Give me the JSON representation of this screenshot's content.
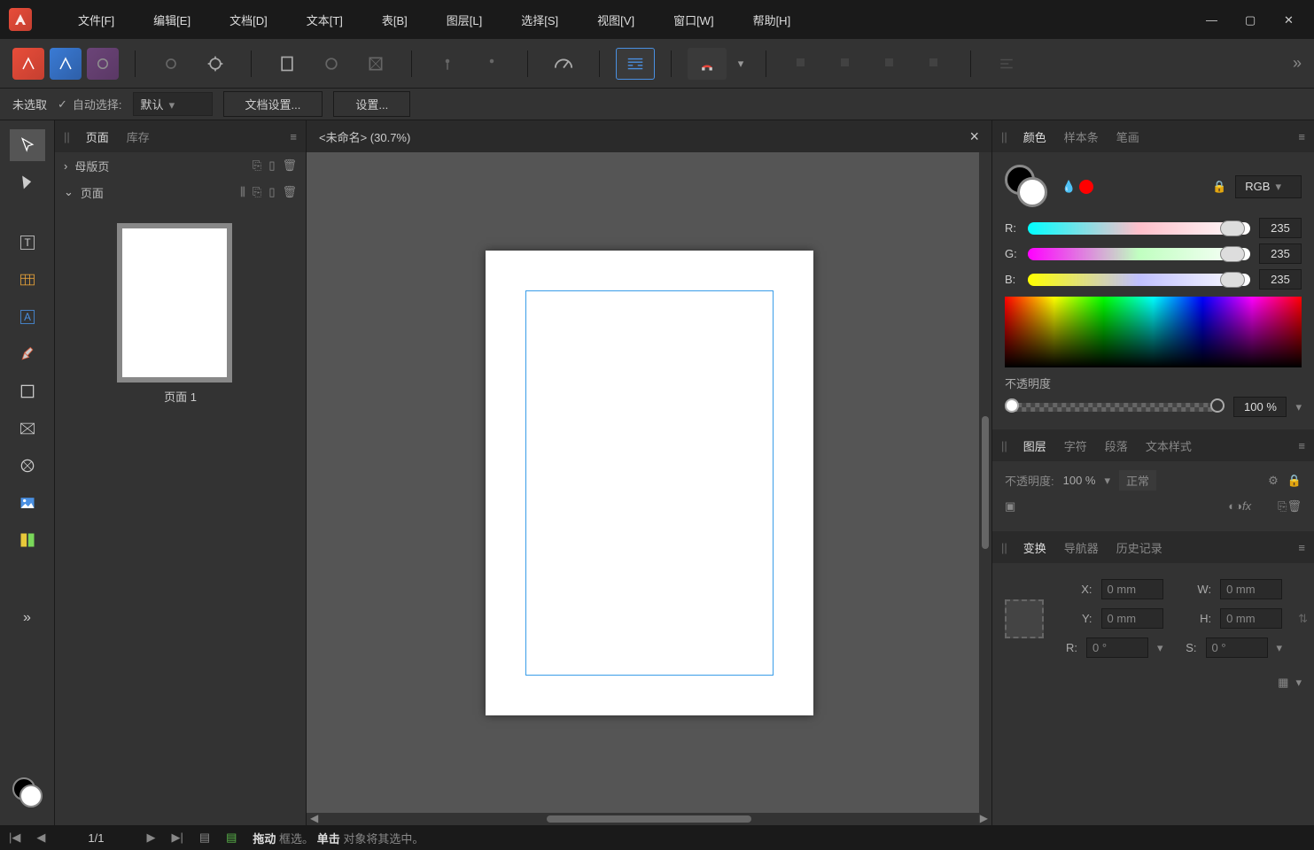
{
  "menu": {
    "file": "文件[F]",
    "edit": "编辑[E]",
    "document": "文档[D]",
    "text": "文本[T]",
    "table": "表[B]",
    "layer": "图层[L]",
    "select": "选择[S]",
    "view": "视图[V]",
    "window": "窗口[W]",
    "help": "帮助[H]"
  },
  "context": {
    "selection_status": "未选取",
    "auto_select_label": "自动选择:",
    "auto_select_value": "默认",
    "doc_setup": "文档设置...",
    "setup": "设置..."
  },
  "pages_panel": {
    "tab_pages": "页面",
    "tab_assets": "库存",
    "master": "母版页",
    "pages": "页面",
    "thumb_label": "页面 1"
  },
  "document": {
    "tab_title": "<未命名> (30.7%)"
  },
  "color_panel": {
    "tab_color": "颜色",
    "tab_swatches": "样本条",
    "tab_stroke": "笔画",
    "mode": "RGB",
    "r_label": "R:",
    "g_label": "G:",
    "b_label": "B:",
    "r": "235",
    "g": "235",
    "b": "235",
    "opacity_label": "不透明度",
    "opacity_value": "100 %"
  },
  "layers_panel": {
    "tab_layers": "图层",
    "tab_character": "字符",
    "tab_paragraph": "段落",
    "tab_textstyle": "文本样式",
    "opacity_label": "不透明度:",
    "opacity_value": "100 %",
    "blend_mode": "正常"
  },
  "transform_panel": {
    "tab_transform": "变换",
    "tab_navigator": "导航器",
    "tab_history": "历史记录",
    "x_label": "X:",
    "y_label": "Y:",
    "w_label": "W:",
    "h_label": "H:",
    "r_label": "R:",
    "s_label": "S:",
    "x": "0 mm",
    "y": "0 mm",
    "w": "0 mm",
    "h": "0 mm",
    "r": "0 °",
    "s": "0 °"
  },
  "status": {
    "page": "1/1",
    "hint_drag": "拖动",
    "hint_drag_txt": " 框选。",
    "hint_click": "单击",
    "hint_click_txt": " 对象将其选中。"
  }
}
